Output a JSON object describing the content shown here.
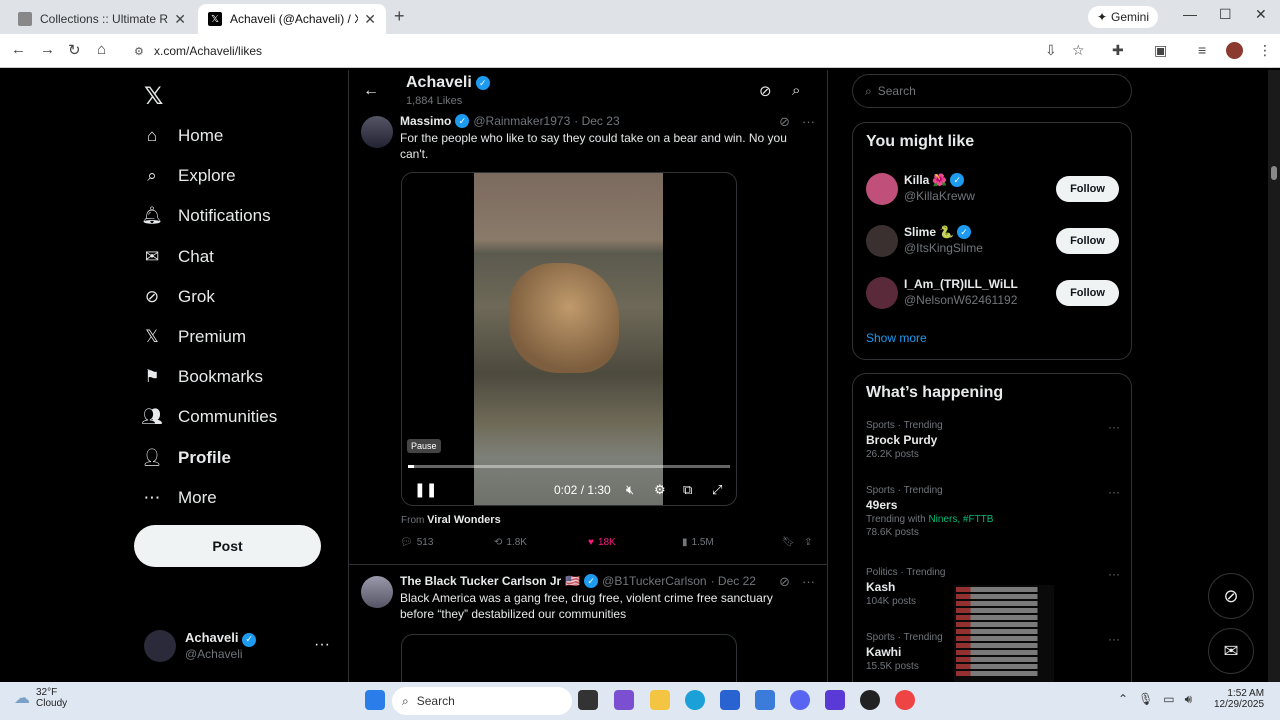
{
  "browser": {
    "tabs": [
      {
        "title": "Collections :: Ultimate Rap Leag"
      },
      {
        "title": "Achaveli (@Achaveli) / X"
      }
    ],
    "new_tab": "+",
    "gemini": "Gemini",
    "url": "x.com/Achaveli/likes"
  },
  "nav": {
    "items": [
      {
        "label": "Home",
        "icon": "home-icon"
      },
      {
        "label": "Explore",
        "icon": "search-icon"
      },
      {
        "label": "Notifications",
        "icon": "bell-icon"
      },
      {
        "label": "Chat",
        "icon": "mail-icon"
      },
      {
        "label": "Grok",
        "icon": "grok-icon"
      },
      {
        "label": "Premium",
        "icon": "x-icon"
      },
      {
        "label": "Bookmarks",
        "icon": "bookmark-icon"
      },
      {
        "label": "Communities",
        "icon": "people-icon"
      },
      {
        "label": "Profile",
        "icon": "user-icon"
      },
      {
        "label": "More",
        "icon": "more-circle-icon"
      }
    ],
    "post_button": "Post",
    "account": {
      "name": "Achaveli",
      "handle": "@Achaveli"
    }
  },
  "header": {
    "name": "Achaveli",
    "likes": "1,884 Likes"
  },
  "tweets": [
    {
      "name": "Massimo",
      "handle": "@Rainmaker1973",
      "date": "· Dec 23",
      "text": "For the people who like to say they could take on a bear and win. No you can't.",
      "video": {
        "tooltip": "Pause",
        "time": "0:02 / 1:30",
        "progress": 0.02
      },
      "from_label": "From",
      "from": "Viral Wonders",
      "stats": {
        "replies": "513",
        "reposts": "1.8K",
        "likes": "18K",
        "views": "1.5M"
      }
    },
    {
      "name": "The Black Tucker Carlson Jr",
      "flag": "🇺🇸",
      "handle": "@B1TuckerCarlson",
      "date": "· Dec 22",
      "text": "Black America was a gang free, drug free, violent crime free sanctuary before “they” destabilized our communities"
    }
  ],
  "right": {
    "search_placeholder": "Search",
    "you_might_like": {
      "title": "You might like",
      "users": [
        {
          "name": "Killa",
          "emoji": "🌺",
          "handle": "@KillaKreww",
          "button": "Follow",
          "color": "#c0507a"
        },
        {
          "name": "Slime",
          "emoji": "🐍",
          "handle": "@ItsKingSlime",
          "button": "Follow",
          "color": "#3a3030"
        },
        {
          "name": "I_Am_(TR)ILL_WiLL",
          "emoji": "",
          "handle": "@NelsonW62461192",
          "button": "Follow",
          "color": "#5a2a3a"
        }
      ],
      "show_more": "Show more"
    },
    "whats_happening": {
      "title": "What’s happening",
      "trends": [
        {
          "category": "Sports · Trending",
          "topic": "Brock Purdy",
          "posts": "26.2K posts"
        },
        {
          "category": "Sports · Trending",
          "topic": "49ers",
          "trending_with": "Trending with",
          "tags": "Niners, #FTTB",
          "posts": "78.6K posts"
        },
        {
          "category": "Politics · Trending",
          "topic": "Kash",
          "posts": "104K posts"
        },
        {
          "category": "Sports · Trending",
          "topic": "Kawhi",
          "posts": "15.5K posts"
        }
      ]
    }
  },
  "taskbar": {
    "temperature": "32°F",
    "weather": "Cloudy",
    "search": "Search",
    "time": "1:52 AM",
    "date": "12/29/2025"
  },
  "colors": {
    "accent": "#1d9bf0",
    "like": "#f91880",
    "background": "#000000",
    "trend_tag": "#00ba7c"
  }
}
